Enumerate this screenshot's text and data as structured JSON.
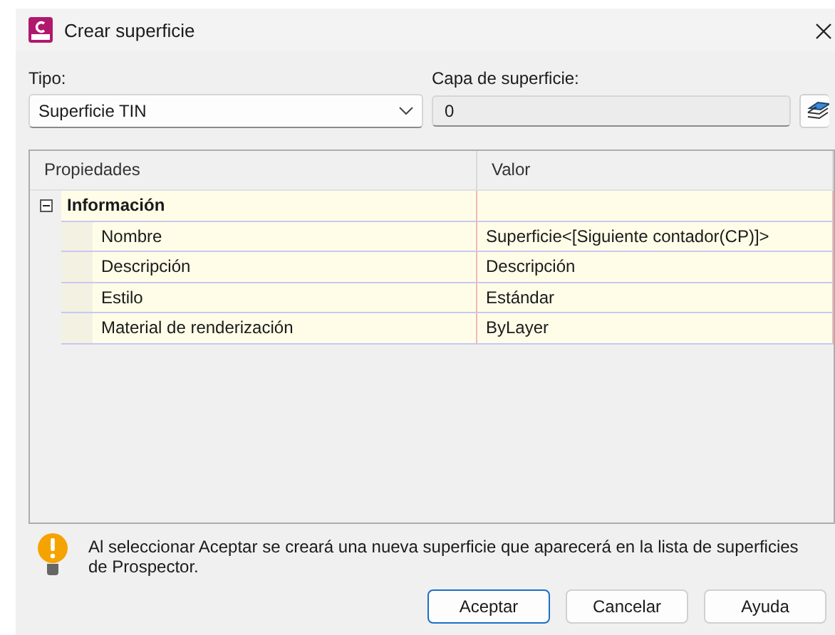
{
  "window": {
    "title": "Crear superficie"
  },
  "tipo": {
    "label": "Tipo:",
    "value": "Superficie TIN"
  },
  "capa": {
    "label": "Capa de superficie:",
    "value": "0"
  },
  "grid": {
    "columns": [
      "Propiedades",
      "Valor"
    ],
    "groups": [
      {
        "label": "Información",
        "expanded": true,
        "rows": [
          {
            "name": "Nombre",
            "value": "Superficie<[Siguiente contador(CP)]>"
          },
          {
            "name": "Descripción",
            "value": "Descripción"
          },
          {
            "name": "Estilo",
            "value": "Estándar"
          },
          {
            "name": "Material de renderización",
            "value": "ByLayer"
          }
        ]
      }
    ]
  },
  "note": "Al seleccionar Aceptar se creará una nueva superficie que aparecerá en la lista de superficies de Prospector.",
  "buttons": [
    {
      "label": "Aceptar",
      "default": true
    },
    {
      "label": "Cancelar",
      "default": false
    },
    {
      "label": "Ayuda",
      "default": false
    }
  ]
}
